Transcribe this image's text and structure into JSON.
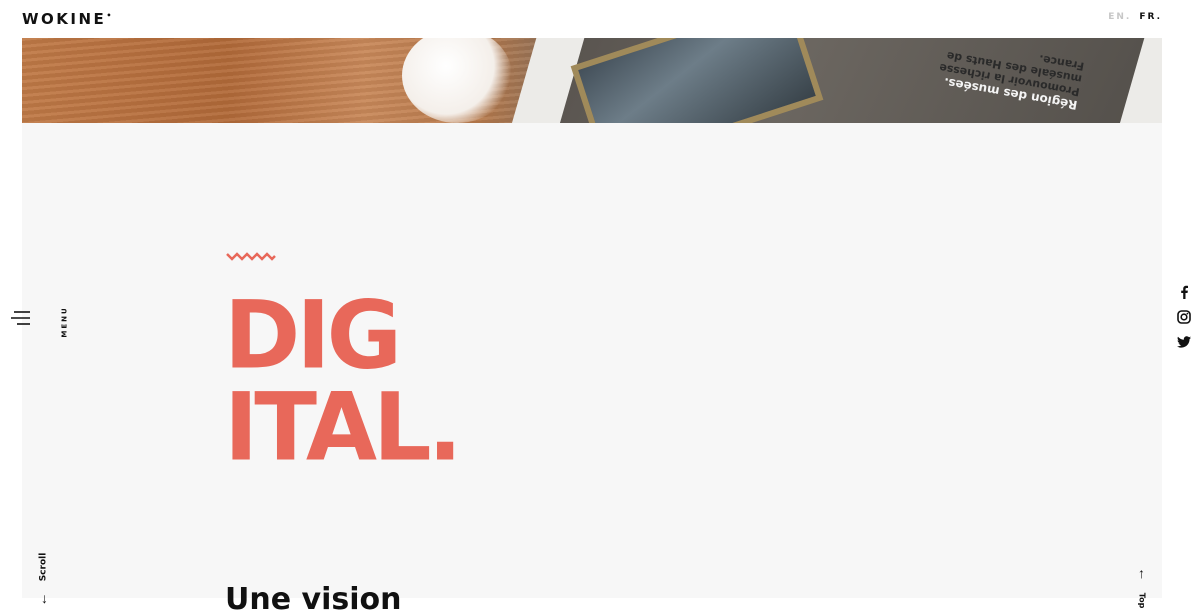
{
  "header": {
    "logo": "WOKINE",
    "logo_mark": "•",
    "languages": [
      {
        "label": "EN.",
        "active": false
      },
      {
        "label": "FR.",
        "active": true
      }
    ]
  },
  "hero_image": {
    "alt": "Région des musées. Promouvoir la richesse muséale des Hauts de France.",
    "screen_text_title": "Région des musées.",
    "screen_text_body": "Promouvoir la richesse muséale des Hauts de France."
  },
  "main": {
    "headline_line1": "DIG",
    "headline_line2": "ITAL.",
    "subheading": "Une vision"
  },
  "nav": {
    "menu_label": "MENU",
    "scroll_label": "Scroll",
    "scroll_arrow": "↓",
    "top_label": "Top",
    "top_arrow": "↑"
  },
  "social": [
    {
      "name": "facebook-icon",
      "label": "f"
    },
    {
      "name": "instagram-icon",
      "label": "instagram"
    },
    {
      "name": "twitter-icon",
      "label": "twitter"
    }
  ],
  "colors": {
    "accent": "#e8685a",
    "panel_bg": "#f7f7f7",
    "text": "#111111",
    "muted": "#c7c7c7"
  }
}
